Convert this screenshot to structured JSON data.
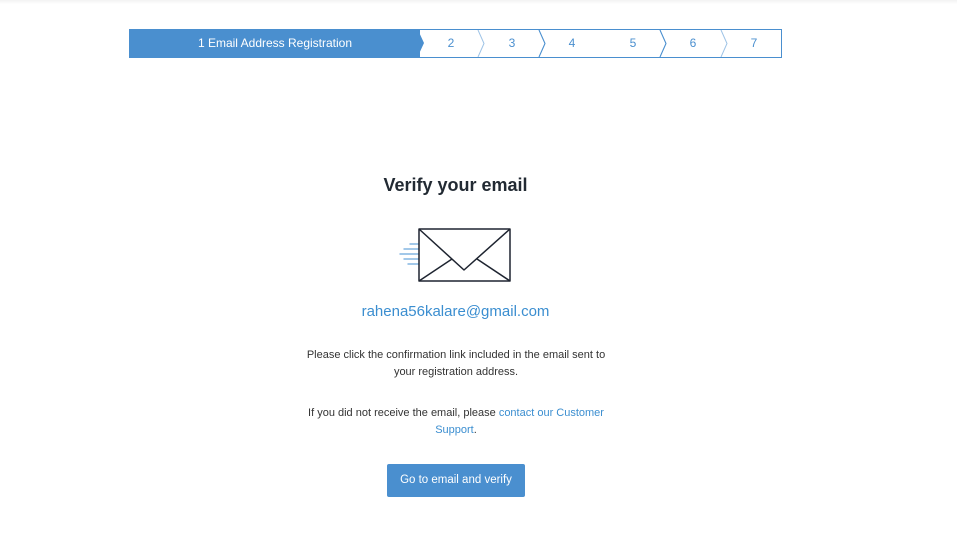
{
  "stepper": {
    "active_label": "1 Email Address Registration",
    "steps": [
      "2",
      "3",
      "4",
      "5",
      "6",
      "7"
    ]
  },
  "main": {
    "title": "Verify your email",
    "email": "rahena56kalare@gmail.com",
    "instruction": "Please click the confirmation link included in the email sent to your registration address.",
    "not_received_prefix": "If you did not receive the email, please ",
    "support_link": "contact our Customer Support",
    "not_received_suffix": ".",
    "verify_button": "Go to email and verify"
  },
  "icons": {
    "envelope": "envelope-icon"
  },
  "colors": {
    "accent": "#4a8fcf",
    "link": "#3b8ed0",
    "title": "#222a33",
    "body_text": "#333333"
  }
}
